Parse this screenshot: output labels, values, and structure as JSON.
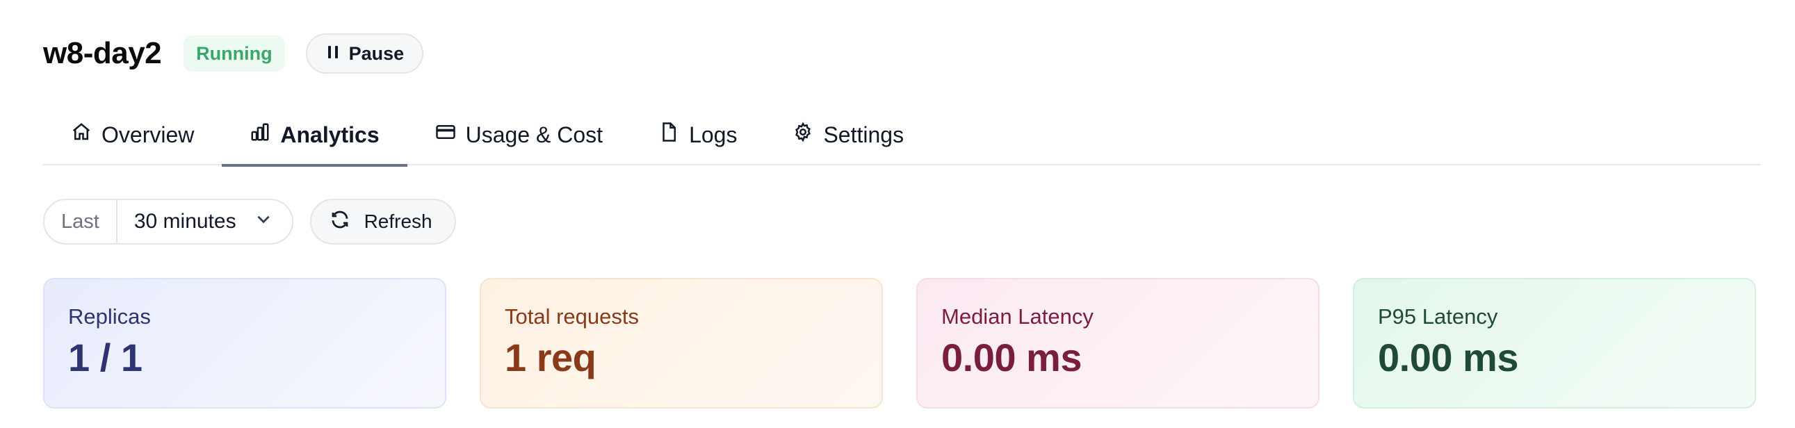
{
  "header": {
    "title": "w8-day2",
    "status": "Running",
    "pause_label": "Pause"
  },
  "tabs": [
    {
      "label": "Overview",
      "icon": "home-icon",
      "active": false
    },
    {
      "label": "Analytics",
      "icon": "bar-chart-icon",
      "active": true
    },
    {
      "label": "Usage & Cost",
      "icon": "credit-card-icon",
      "active": false
    },
    {
      "label": "Logs",
      "icon": "file-icon",
      "active": false
    },
    {
      "label": "Settings",
      "icon": "gear-icon",
      "active": false
    }
  ],
  "controls": {
    "range_label": "Last",
    "range_value": "30 minutes",
    "refresh_label": "Refresh"
  },
  "metrics": [
    {
      "label": "Replicas",
      "value": "1 / 1"
    },
    {
      "label": "Total requests",
      "value": "1 req"
    },
    {
      "label": "Median Latency",
      "value": "0.00 ms"
    },
    {
      "label": "P95 Latency",
      "value": "0.00 ms"
    }
  ],
  "colors": {
    "status_green": "#3aa86a",
    "tab_underline": "#6b7280",
    "replicas": "#2d3470",
    "requests": "#8a3a18",
    "median": "#7a1e3f",
    "p95": "#1f4a35"
  }
}
